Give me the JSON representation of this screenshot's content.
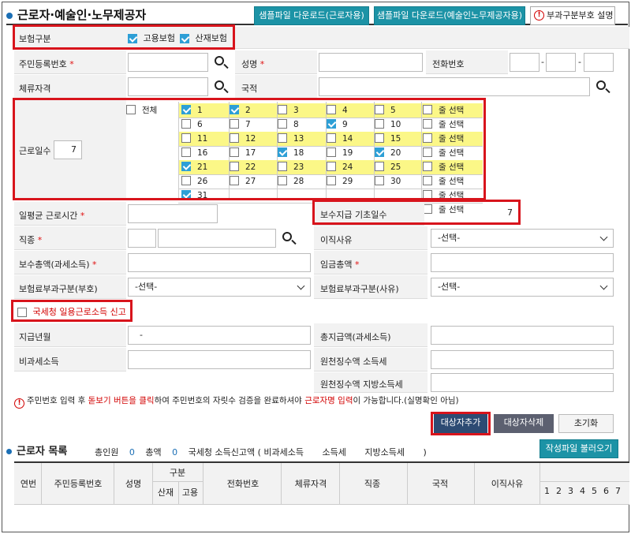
{
  "header": {
    "title": "근로자·예술인·노무제공자",
    "btn_sample_worker": "샘플파일 다운로드(근로자용)",
    "btn_sample_artist": "샘플파일 다운로드(예술인노무제공자용)",
    "btn_code_desc": "부과구분부호 설명"
  },
  "insurance": {
    "label": "보험구분",
    "employment_label": "고용보험",
    "industrial_label": "산재보험",
    "employment_checked": true,
    "industrial_checked": true
  },
  "fields": {
    "resident_no": "주민등록번호",
    "name": "성명",
    "phone": "전화번호",
    "phone_sep1": "-",
    "phone_sep2": "-",
    "stay_status": "체류자격",
    "nationality": "국적",
    "work_days": "근로일수",
    "work_days_value": "7",
    "daily_hours": "일평균 근로시간",
    "pay_basis_days": "보수지급 기초일수",
    "pay_basis_days_value": "7",
    "job_type": "직종",
    "leave_reason": "이직사유",
    "leave_reason_value": "-선택-",
    "total_pay": "보수총액(과세소득)",
    "wage_total": "임금총액",
    "levy_code": "보험료부과구분(부호)",
    "levy_code_value": "-선택-",
    "levy_reason": "보험료부과구분(사유)",
    "levy_reason_value": "-선택-",
    "tax_report": "국세청 일용근로소득 신고",
    "pay_month": "지급년월",
    "pay_month_value": "-",
    "total_paid": "총지급액(과세소득)",
    "non_taxable": "비과세소득",
    "withholding_income": "원천징수액 소득세",
    "withholding_local": "원천징수액 지방소득세"
  },
  "days": {
    "all_label": "전체",
    "row_select": "줄 선택",
    "rows": [
      [
        {
          "d": "1",
          "on": true
        },
        {
          "d": "2",
          "on": true
        },
        {
          "d": "3",
          "on": false
        },
        {
          "d": "4",
          "on": false
        },
        {
          "d": "5",
          "on": false
        }
      ],
      [
        {
          "d": "6",
          "on": false
        },
        {
          "d": "7",
          "on": false
        },
        {
          "d": "8",
          "on": false
        },
        {
          "d": "9",
          "on": true
        },
        {
          "d": "10",
          "on": false
        }
      ],
      [
        {
          "d": "11",
          "on": false
        },
        {
          "d": "12",
          "on": false
        },
        {
          "d": "13",
          "on": false
        },
        {
          "d": "14",
          "on": false
        },
        {
          "d": "15",
          "on": false
        }
      ],
      [
        {
          "d": "16",
          "on": false
        },
        {
          "d": "17",
          "on": false
        },
        {
          "d": "18",
          "on": true
        },
        {
          "d": "19",
          "on": false
        },
        {
          "d": "20",
          "on": true
        }
      ],
      [
        {
          "d": "21",
          "on": true
        },
        {
          "d": "22",
          "on": false
        },
        {
          "d": "23",
          "on": false
        },
        {
          "d": "24",
          "on": false
        },
        {
          "d": "25",
          "on": false
        }
      ],
      [
        {
          "d": "26",
          "on": false
        },
        {
          "d": "27",
          "on": false
        },
        {
          "d": "28",
          "on": false
        },
        {
          "d": "29",
          "on": false
        },
        {
          "d": "30",
          "on": false
        }
      ],
      [
        {
          "d": "31",
          "on": true
        }
      ]
    ],
    "highlight_rows": [
      0,
      2,
      4
    ]
  },
  "notice": {
    "part1": "주민번호 입력 후 ",
    "part2": "돋보기 버튼을 클릭",
    "part3": "하여 주민번호의 자릿수 검증을 완료하셔야 ",
    "part4": "근로자명 입력",
    "part5": "이 가능합니다.(실명확인 아님)"
  },
  "actions": {
    "add": "대상자추가",
    "delete": "대상자삭제",
    "reset": "초기화"
  },
  "list": {
    "title": "근로자 목록",
    "total_people_label": "총인원",
    "total_people": "0",
    "total_amount_label": "총액",
    "total_amount": "0",
    "tax_label": "국세청 소득신고액 ( 비과세소득",
    "income_tax_label": "소득세",
    "local_tax_label": "지방소득세",
    "close_paren": ")",
    "load_btn": "작성파일 불러오기",
    "columns": {
      "seq": "연번",
      "resident_no": "주민등록번호",
      "name": "성명",
      "category": "구분",
      "industrial": "산재",
      "employment": "고용",
      "phone": "전화번호",
      "stay_status": "체류자격",
      "job": "직종",
      "nationality": "국적",
      "leave_reason": "이직사유"
    },
    "day_numbers": [
      "1",
      "2",
      "3",
      "4",
      "5",
      "6",
      "7"
    ]
  },
  "colors": {
    "accent_teal": "#1c93a6",
    "highlight_red": "#d8141c",
    "highlight_yellow": "#fbf787",
    "check_blue": "#2d9fd6"
  }
}
